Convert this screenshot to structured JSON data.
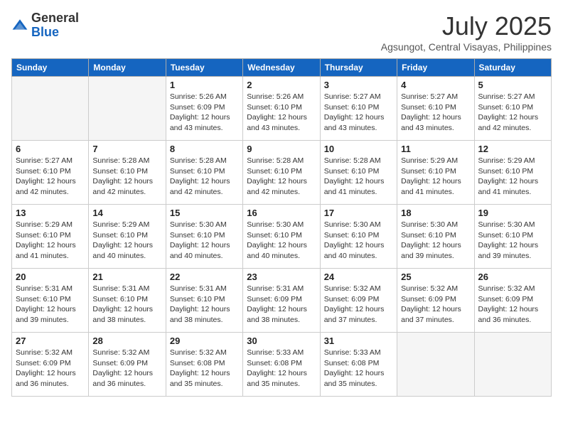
{
  "header": {
    "logo": {
      "general": "General",
      "blue": "Blue"
    },
    "title": "July 2025",
    "subtitle": "Agsungot, Central Visayas, Philippines"
  },
  "calendar": {
    "weekdays": [
      "Sunday",
      "Monday",
      "Tuesday",
      "Wednesday",
      "Thursday",
      "Friday",
      "Saturday"
    ],
    "weeks": [
      [
        {
          "day": "",
          "info": ""
        },
        {
          "day": "",
          "info": ""
        },
        {
          "day": "1",
          "info": "Sunrise: 5:26 AM\nSunset: 6:09 PM\nDaylight: 12 hours and 43 minutes."
        },
        {
          "day": "2",
          "info": "Sunrise: 5:26 AM\nSunset: 6:10 PM\nDaylight: 12 hours and 43 minutes."
        },
        {
          "day": "3",
          "info": "Sunrise: 5:27 AM\nSunset: 6:10 PM\nDaylight: 12 hours and 43 minutes."
        },
        {
          "day": "4",
          "info": "Sunrise: 5:27 AM\nSunset: 6:10 PM\nDaylight: 12 hours and 43 minutes."
        },
        {
          "day": "5",
          "info": "Sunrise: 5:27 AM\nSunset: 6:10 PM\nDaylight: 12 hours and 42 minutes."
        }
      ],
      [
        {
          "day": "6",
          "info": "Sunrise: 5:27 AM\nSunset: 6:10 PM\nDaylight: 12 hours and 42 minutes."
        },
        {
          "day": "7",
          "info": "Sunrise: 5:28 AM\nSunset: 6:10 PM\nDaylight: 12 hours and 42 minutes."
        },
        {
          "day": "8",
          "info": "Sunrise: 5:28 AM\nSunset: 6:10 PM\nDaylight: 12 hours and 42 minutes."
        },
        {
          "day": "9",
          "info": "Sunrise: 5:28 AM\nSunset: 6:10 PM\nDaylight: 12 hours and 42 minutes."
        },
        {
          "day": "10",
          "info": "Sunrise: 5:28 AM\nSunset: 6:10 PM\nDaylight: 12 hours and 41 minutes."
        },
        {
          "day": "11",
          "info": "Sunrise: 5:29 AM\nSunset: 6:10 PM\nDaylight: 12 hours and 41 minutes."
        },
        {
          "day": "12",
          "info": "Sunrise: 5:29 AM\nSunset: 6:10 PM\nDaylight: 12 hours and 41 minutes."
        }
      ],
      [
        {
          "day": "13",
          "info": "Sunrise: 5:29 AM\nSunset: 6:10 PM\nDaylight: 12 hours and 41 minutes."
        },
        {
          "day": "14",
          "info": "Sunrise: 5:29 AM\nSunset: 6:10 PM\nDaylight: 12 hours and 40 minutes."
        },
        {
          "day": "15",
          "info": "Sunrise: 5:30 AM\nSunset: 6:10 PM\nDaylight: 12 hours and 40 minutes."
        },
        {
          "day": "16",
          "info": "Sunrise: 5:30 AM\nSunset: 6:10 PM\nDaylight: 12 hours and 40 minutes."
        },
        {
          "day": "17",
          "info": "Sunrise: 5:30 AM\nSunset: 6:10 PM\nDaylight: 12 hours and 40 minutes."
        },
        {
          "day": "18",
          "info": "Sunrise: 5:30 AM\nSunset: 6:10 PM\nDaylight: 12 hours and 39 minutes."
        },
        {
          "day": "19",
          "info": "Sunrise: 5:30 AM\nSunset: 6:10 PM\nDaylight: 12 hours and 39 minutes."
        }
      ],
      [
        {
          "day": "20",
          "info": "Sunrise: 5:31 AM\nSunset: 6:10 PM\nDaylight: 12 hours and 39 minutes."
        },
        {
          "day": "21",
          "info": "Sunrise: 5:31 AM\nSunset: 6:10 PM\nDaylight: 12 hours and 38 minutes."
        },
        {
          "day": "22",
          "info": "Sunrise: 5:31 AM\nSunset: 6:10 PM\nDaylight: 12 hours and 38 minutes."
        },
        {
          "day": "23",
          "info": "Sunrise: 5:31 AM\nSunset: 6:09 PM\nDaylight: 12 hours and 38 minutes."
        },
        {
          "day": "24",
          "info": "Sunrise: 5:32 AM\nSunset: 6:09 PM\nDaylight: 12 hours and 37 minutes."
        },
        {
          "day": "25",
          "info": "Sunrise: 5:32 AM\nSunset: 6:09 PM\nDaylight: 12 hours and 37 minutes."
        },
        {
          "day": "26",
          "info": "Sunrise: 5:32 AM\nSunset: 6:09 PM\nDaylight: 12 hours and 36 minutes."
        }
      ],
      [
        {
          "day": "27",
          "info": "Sunrise: 5:32 AM\nSunset: 6:09 PM\nDaylight: 12 hours and 36 minutes."
        },
        {
          "day": "28",
          "info": "Sunrise: 5:32 AM\nSunset: 6:09 PM\nDaylight: 12 hours and 36 minutes."
        },
        {
          "day": "29",
          "info": "Sunrise: 5:32 AM\nSunset: 6:08 PM\nDaylight: 12 hours and 35 minutes."
        },
        {
          "day": "30",
          "info": "Sunrise: 5:33 AM\nSunset: 6:08 PM\nDaylight: 12 hours and 35 minutes."
        },
        {
          "day": "31",
          "info": "Sunrise: 5:33 AM\nSunset: 6:08 PM\nDaylight: 12 hours and 35 minutes."
        },
        {
          "day": "",
          "info": ""
        },
        {
          "day": "",
          "info": ""
        }
      ]
    ]
  }
}
